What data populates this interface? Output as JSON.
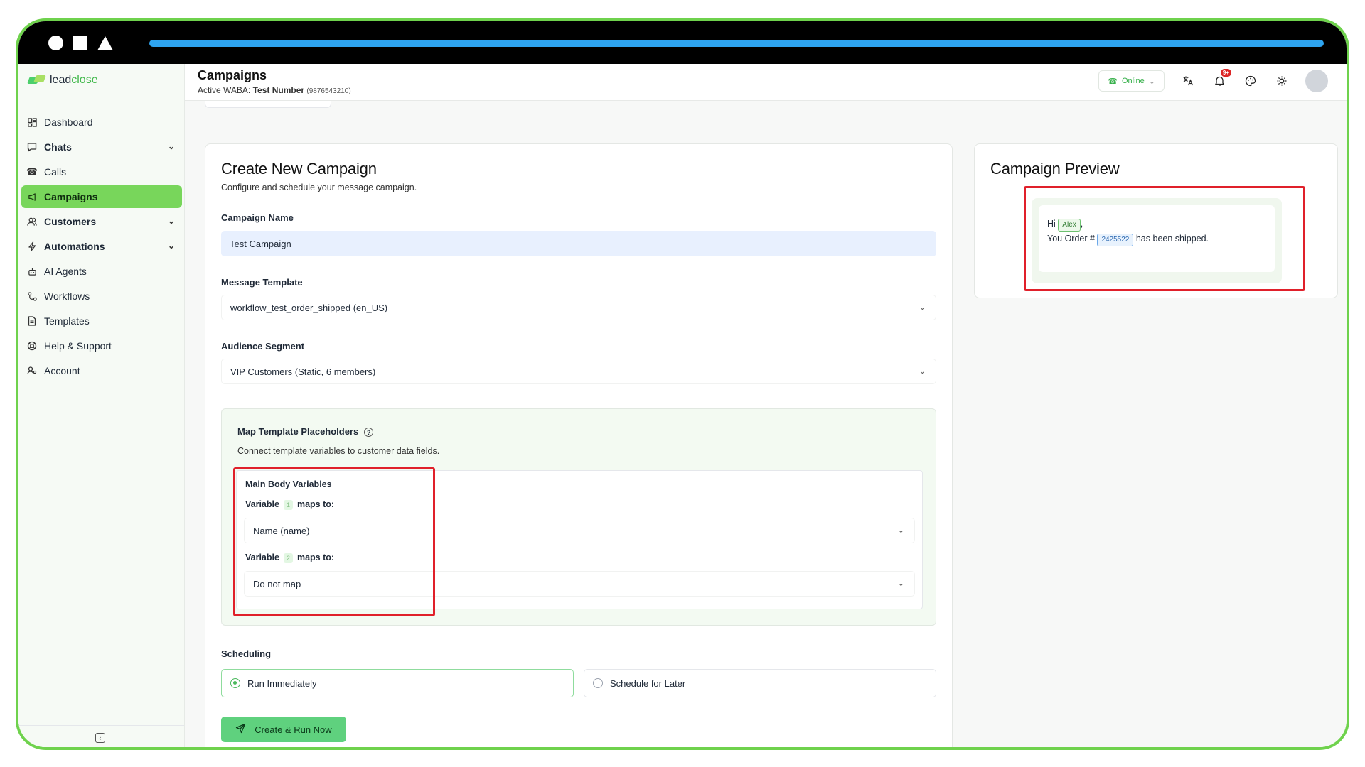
{
  "brand": {
    "name_a": "lead",
    "name_b": "close"
  },
  "sidebar": {
    "items": [
      {
        "label": "Dashboard",
        "icon": "dashboard-icon"
      },
      {
        "label": "Chats",
        "icon": "chat-icon"
      },
      {
        "label": "Calls",
        "icon": "phone-icon"
      },
      {
        "label": "Campaigns",
        "icon": "megaphone-icon"
      },
      {
        "label": "Customers",
        "icon": "users-icon"
      },
      {
        "label": "Automations",
        "icon": "lightning-icon"
      },
      {
        "label": "AI Agents",
        "icon": "robot-icon"
      },
      {
        "label": "Workflows",
        "icon": "workflow-icon"
      },
      {
        "label": "Templates",
        "icon": "document-icon"
      },
      {
        "label": "Help & Support",
        "icon": "lifebuoy-icon"
      },
      {
        "label": "Account",
        "icon": "account-icon"
      }
    ]
  },
  "header": {
    "title": "Campaigns",
    "waba_prefix": "Active WABA:",
    "waba_name": "Test Number",
    "waba_number": "(9876543210)",
    "status": "Online",
    "notification_badge": "9+"
  },
  "form": {
    "title": "Create New Campaign",
    "description": "Configure and schedule your message campaign.",
    "campaign_name_label": "Campaign Name",
    "campaign_name_value": "Test Campaign",
    "template_label": "Message Template",
    "template_value": "workflow_test_order_shipped (en_US)",
    "audience_label": "Audience Segment",
    "audience_value": "VIP Customers (Static, 6 members)",
    "map": {
      "title": "Map Template Placeholders",
      "description": "Connect template variables to customer data fields.",
      "section": "Main Body Variables",
      "var_word": "Variable",
      "maps_to": "maps to:",
      "var1_num": "1",
      "var1_value": "Name (name)",
      "var2_num": "2",
      "var2_value": "Do not map"
    },
    "scheduling_label": "Scheduling",
    "run_now": "Run Immediately",
    "schedule_later": "Schedule for Later",
    "submit": "Create & Run Now"
  },
  "preview": {
    "title": "Campaign Preview",
    "hi": "Hi",
    "name_chip": "Alex",
    "comma": ",",
    "order_prefix": "You Order #",
    "order_chip": "2425522",
    "order_suffix": "has been shipped."
  },
  "colors": {
    "accent": "#78d65b",
    "button": "#5fd17e",
    "highlight_border": "#e0202a",
    "frame": "#6fd24d"
  }
}
